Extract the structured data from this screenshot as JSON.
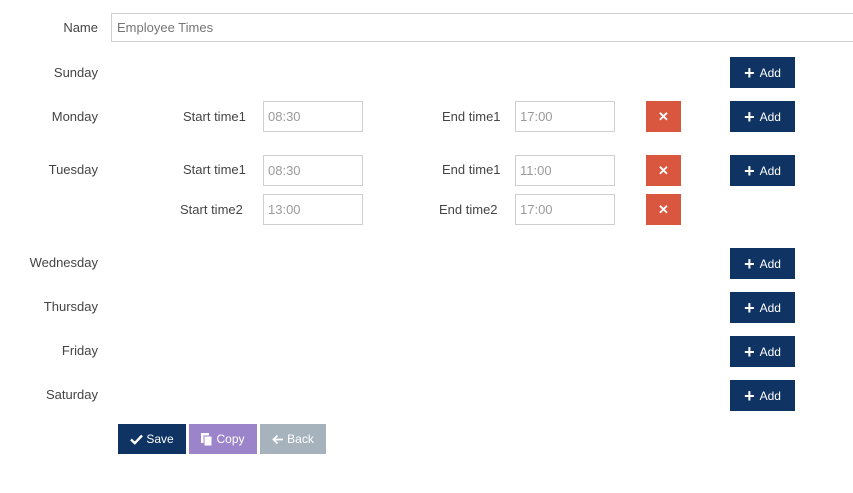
{
  "name": {
    "label": "Name",
    "placeholder": "Employee Times"
  },
  "days": {
    "sunday": "Sunday",
    "monday": "Monday",
    "tuesday": "Tuesday",
    "wednesday": "Wednesday",
    "thursday": "Thursday",
    "friday": "Friday",
    "saturday": "Saturday"
  },
  "slots": {
    "monday_1": {
      "start_label": "Start time1",
      "start": "08:30",
      "end_label": "End time1",
      "end": "17:00"
    },
    "tuesday_1": {
      "start_label": "Start time1",
      "start": "08:30",
      "end_label": "End time1",
      "end": "11:00"
    },
    "tuesday_2": {
      "start_label": "Start time2",
      "start": "13:00",
      "end_label": "End time2",
      "end": "17:00"
    }
  },
  "buttons": {
    "add": "Add",
    "delete_icon": "✕",
    "save": "Save",
    "copy": "Copy",
    "back": "Back"
  },
  "icons": {
    "plus": "plus-icon",
    "times": "close-icon",
    "check": "check-icon",
    "copy": "copy-icon",
    "arrow_left": "arrow-left-icon"
  },
  "colors": {
    "primary": "#0f3362",
    "danger": "#d9573f",
    "copy": "#9b84c9",
    "back": "#a6b3bd"
  }
}
